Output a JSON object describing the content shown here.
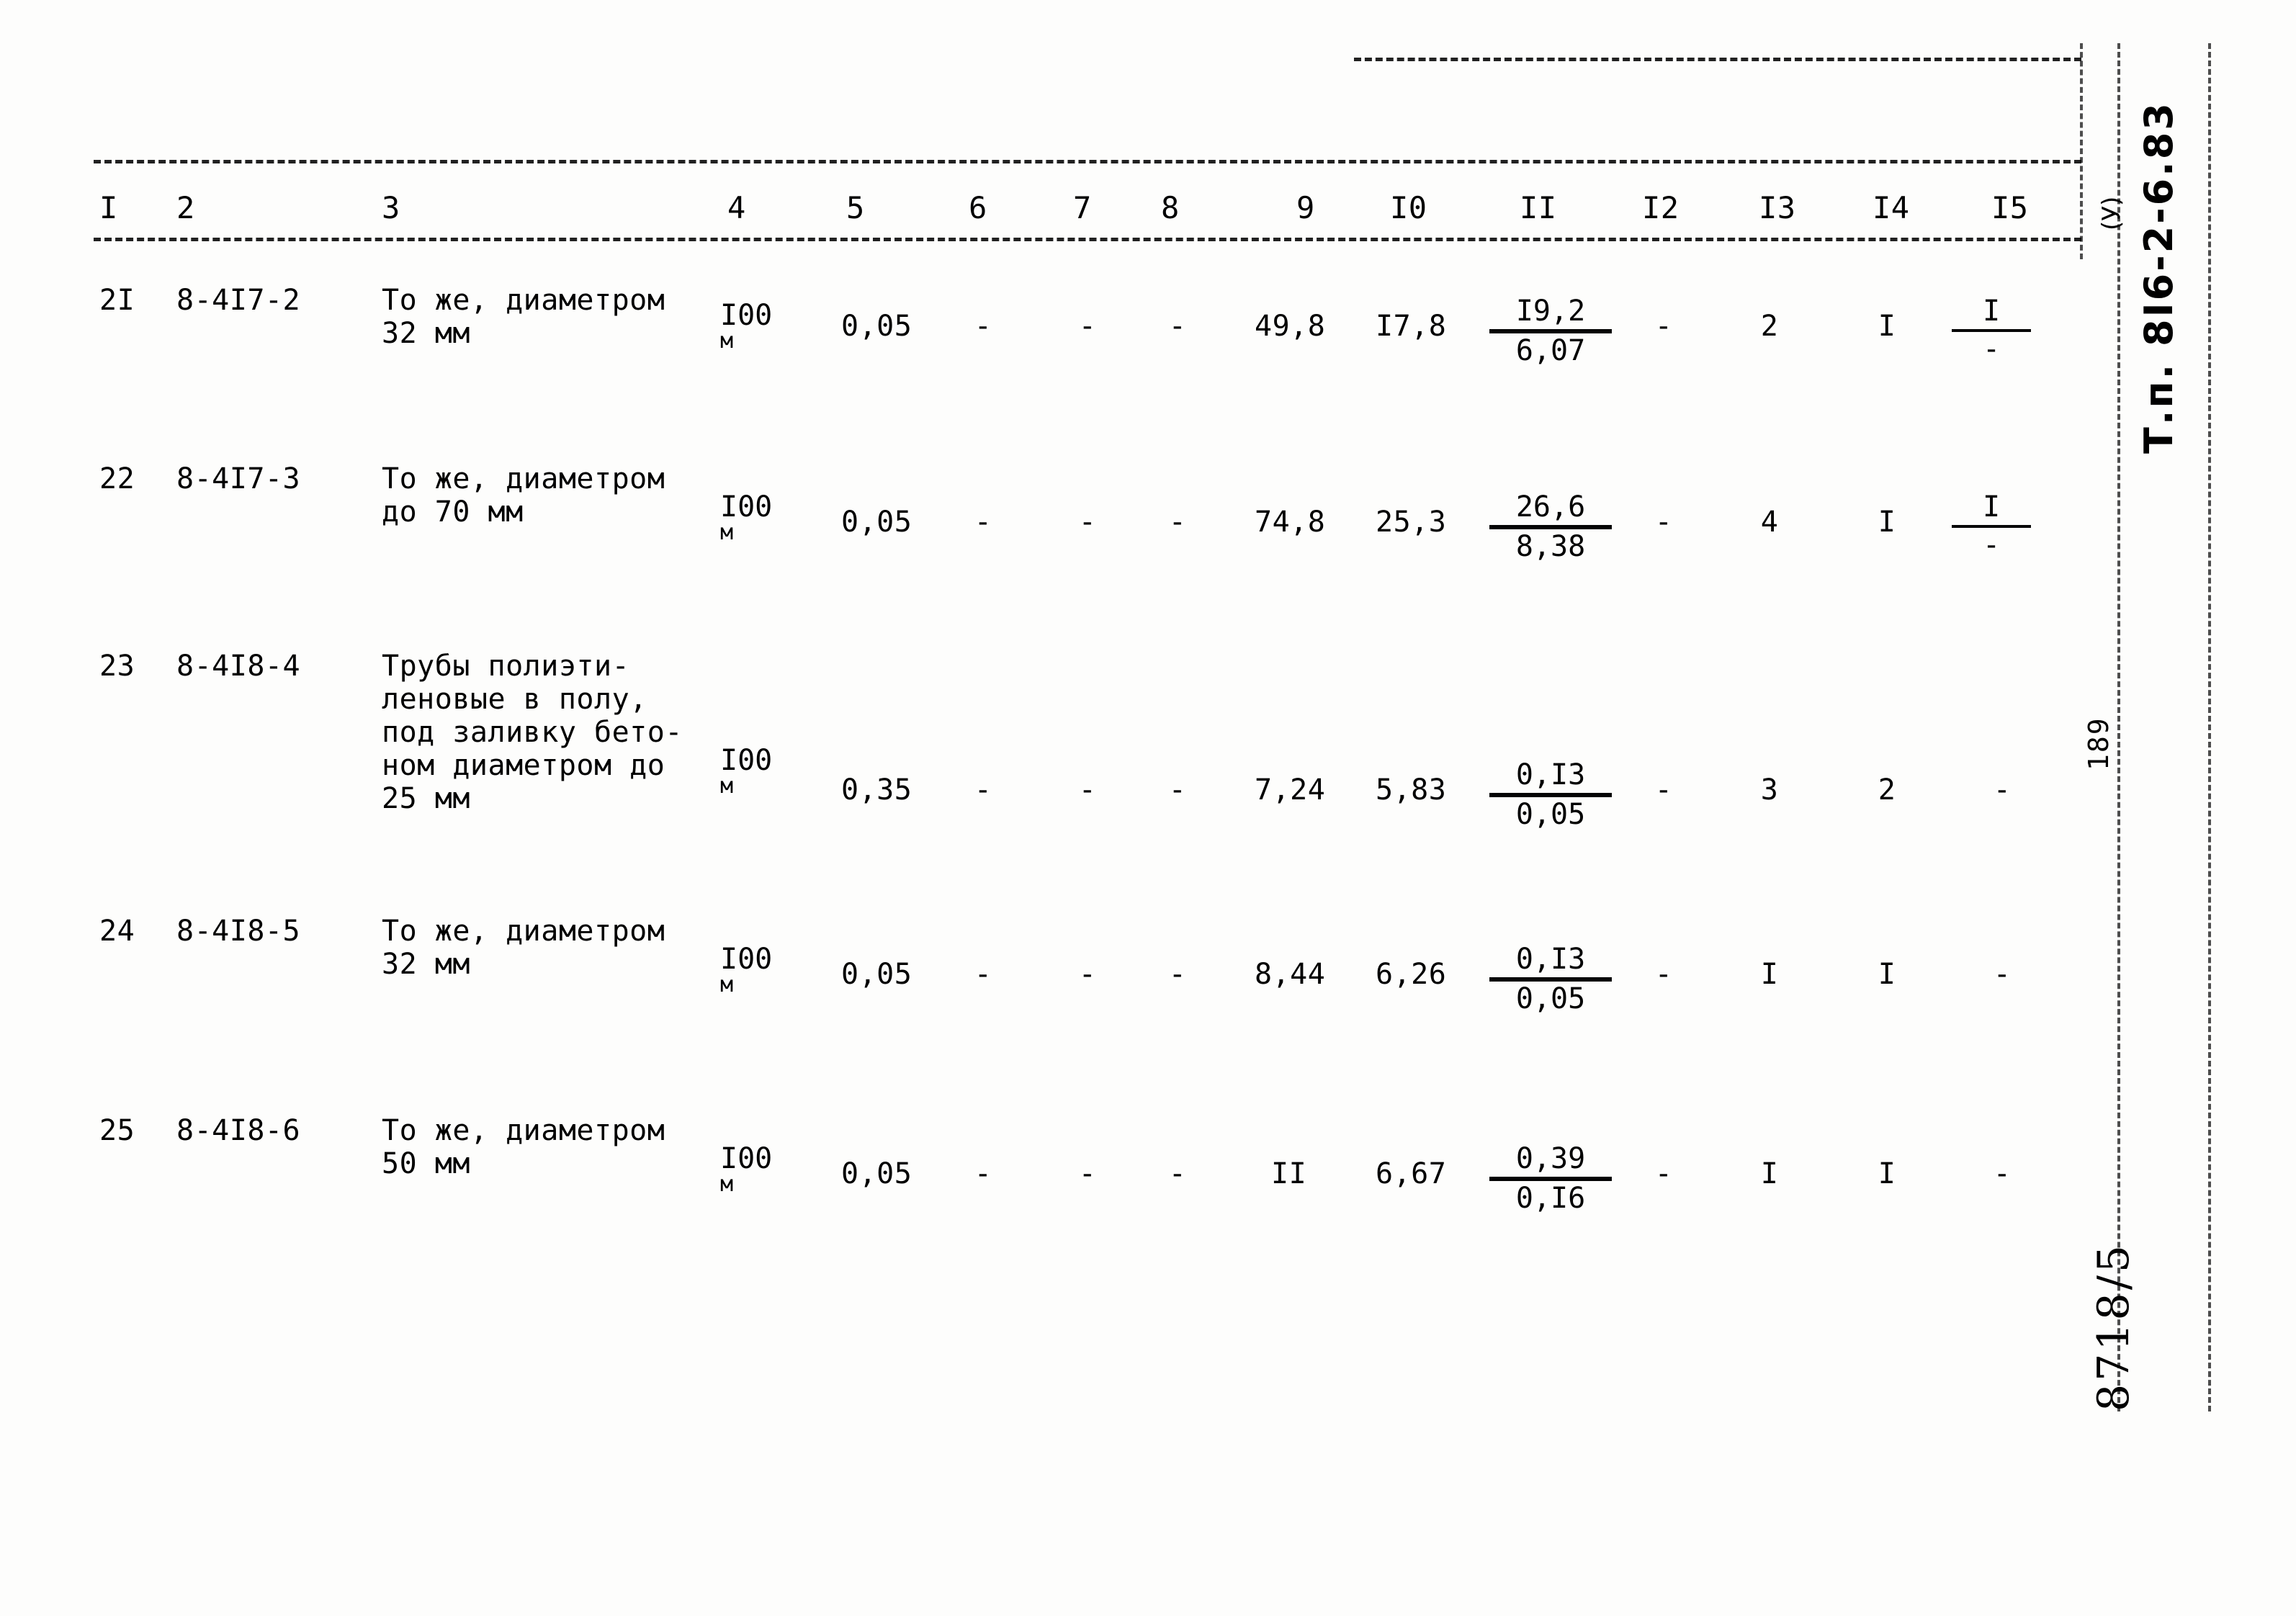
{
  "document": {
    "id_vertical": "Т.п. 8I6-2-6.83",
    "id_suffix": "(У)",
    "page_number": "189",
    "bottom_stamp": "8718/5"
  },
  "table": {
    "column_headers": [
      "I",
      "2",
      "3",
      "4",
      "5",
      "6",
      "7",
      "8",
      "9",
      "I0",
      "II",
      "I2",
      "I3",
      "I4",
      "I5"
    ],
    "rows": [
      {
        "num": "2I",
        "code": "8-4I7-2",
        "desc_lines": [
          "То же, диаметром",
          "32 мм"
        ],
        "unit_top": "I00",
        "unit_bottom": "м",
        "c5": "0,05",
        "c6": "-",
        "c7": "-",
        "c8": "-",
        "c9": "49,8",
        "c10": "I7,8",
        "c11_top": "I9,2",
        "c11_bottom": "6,07",
        "c12": "-",
        "c13": "2",
        "c14": "I",
        "c15_top": "I",
        "c15_bottom": "-"
      },
      {
        "num": "22",
        "code": "8-4I7-3",
        "desc_lines": [
          "То же, диаметром",
          "до 70 мм"
        ],
        "unit_top": "I00",
        "unit_bottom": "м",
        "c5": "0,05",
        "c6": "-",
        "c7": "-",
        "c8": "-",
        "c9": "74,8",
        "c10": "25,3",
        "c11_top": "26,6",
        "c11_bottom": "8,38",
        "c12": "-",
        "c13": "4",
        "c14": "I",
        "c15_top": "I",
        "c15_bottom": "-"
      },
      {
        "num": "23",
        "code": "8-4I8-4",
        "desc_lines": [
          "Трубы полиэти-",
          "леновые в полу,",
          "под заливку бето-",
          "ном диаметром до",
          "25 мм"
        ],
        "unit_top": "I00",
        "unit_bottom": "м",
        "c5": "0,35",
        "c6": "-",
        "c7": "-",
        "c8": "-",
        "c9": "7,24",
        "c10": "5,83",
        "c11_top": "0,I3",
        "c11_bottom": "0,05",
        "c12": "-",
        "c13": "3",
        "c14": "2",
        "c15_top": "-",
        "c15_bottom": ""
      },
      {
        "num": "24",
        "code": "8-4I8-5",
        "desc_lines": [
          "То же, диаметром",
          "32 мм"
        ],
        "unit_top": "I00",
        "unit_bottom": "м",
        "c5": "0,05",
        "c6": "-",
        "c7": "-",
        "c8": "-",
        "c9": "8,44",
        "c10": "6,26",
        "c11_top": "0,I3",
        "c11_bottom": "0,05",
        "c12": "-",
        "c13": "I",
        "c14": "I",
        "c15_top": "-",
        "c15_bottom": ""
      },
      {
        "num": "25",
        "code": "8-4I8-6",
        "desc_lines": [
          "То же, диаметром",
          "50 мм"
        ],
        "unit_top": "I00",
        "unit_bottom": "м",
        "c5": "0,05",
        "c6": "-",
        "c7": "-",
        "c8": "-",
        "c9": "II",
        "c10": "6,67",
        "c11_top": "0,39",
        "c11_bottom": "0,I6",
        "c12": "-",
        "c13": "I",
        "c14": "I",
        "c15_top": "-",
        "c15_bottom": ""
      }
    ]
  }
}
